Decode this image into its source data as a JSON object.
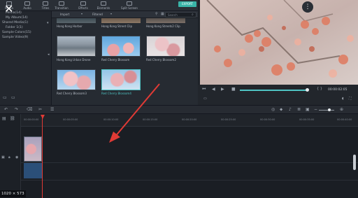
{
  "toolbar": {
    "items": [
      {
        "label": "Media",
        "icon": "media-icon"
      },
      {
        "label": "Audio",
        "icon": "audio-icon"
      },
      {
        "label": "Titles",
        "icon": "titles-icon"
      },
      {
        "label": "Transition",
        "icon": "transition-icon"
      },
      {
        "label": "Effects",
        "icon": "effects-icon"
      },
      {
        "label": "Elements",
        "icon": "elements-icon"
      },
      {
        "label": "Split Screen",
        "icon": "split-screen-icon"
      }
    ],
    "export_label": "EXPORT"
  },
  "library": {
    "items": [
      {
        "label": "Media(14)"
      },
      {
        "label": "My Album(14)"
      },
      {
        "label": "Shared Media(1)"
      },
      {
        "label": "Folder 1(1)"
      },
      {
        "label": "Sample Colors(15)"
      },
      {
        "label": "Sample Video(9)"
      }
    ]
  },
  "media": {
    "import_label": "Import",
    "filter_label": "Filtered",
    "search_placeholder": "Search",
    "row0_captions": [
      "Hong Kong Harbor",
      "Hong Kong Street Clip",
      "Hong Kong Streets2 Clip"
    ],
    "clips": [
      {
        "caption": "Hong Kong Urban Drone"
      },
      {
        "caption": "Red Cherry Blossom"
      },
      {
        "caption": "Red Cherry Blossom2"
      },
      {
        "caption": "Red Cherry Blossom3"
      },
      {
        "caption": "Red Cherry Blossom4"
      }
    ]
  },
  "preview": {
    "timecode": "00:00:02:05"
  },
  "timeline": {
    "ruler_ticks": [
      "00:00:00:00",
      "00:00:05:00",
      "00:00:10:00",
      "00:00:15:00",
      "00:00:20:00",
      "00:00:25:00",
      "00:00:30:00",
      "00:00:35:00",
      "00:00:40:00"
    ],
    "playhead_fraction": 0.05
  },
  "overlay": {
    "dimensions": "1020 × 573"
  },
  "colors": {
    "accent": "#4fc3c3",
    "arrow": "#e03a35",
    "playhead": "#e03a35"
  }
}
